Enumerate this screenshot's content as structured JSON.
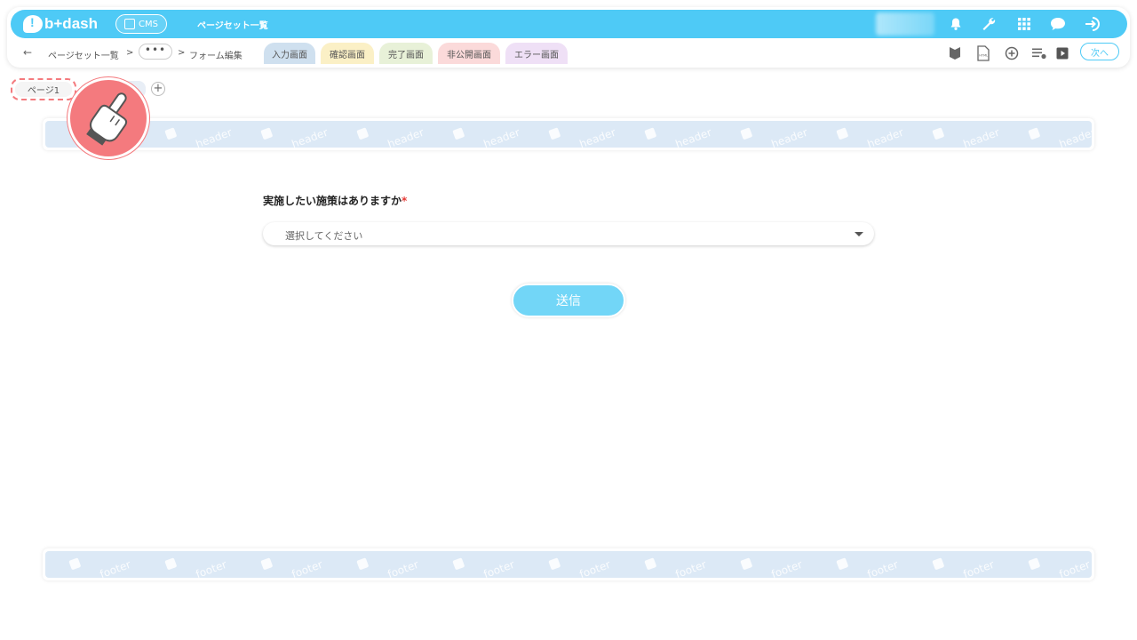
{
  "app": {
    "logo_text": "b+dash",
    "cms_label": "CMS",
    "top_title": "ページセット一覧"
  },
  "top_icons": [
    "bell-icon",
    "wrench-icon",
    "grid-icon",
    "chat-icon",
    "logout-icon"
  ],
  "breadcrumb": {
    "items": [
      "ページセット一覧",
      ">",
      "•••",
      ">",
      "フォーム編集"
    ]
  },
  "screen_tabs": [
    {
      "label": "入力画面",
      "color": "#cfe0ef",
      "active": true
    },
    {
      "label": "確認画面",
      "color": "#fbf0c6"
    },
    {
      "label": "完了画面",
      "color": "#e8f1d8"
    },
    {
      "label": "非公開画面",
      "color": "#fbdada"
    },
    {
      "label": "エラー画面",
      "color": "#efe0f6"
    }
  ],
  "right_icons": [
    "beginner-mark-icon",
    "html-file-icon",
    "add-circle-icon",
    "settings-list-icon",
    "video-play-icon"
  ],
  "next_label": "次へ",
  "pages": {
    "active_label": "ページ1"
  },
  "header_band": {
    "word": "header"
  },
  "footer_band": {
    "word": "footer"
  },
  "form": {
    "question": "実施したい施策はありますか",
    "required_mark": "*",
    "select_placeholder": "選択してください",
    "submit_label": "送信"
  },
  "colors": {
    "brand": "#4ecaf6",
    "highlight": "#f47a7e",
    "band": "#dce9f6",
    "submit": "#72d6f7"
  }
}
